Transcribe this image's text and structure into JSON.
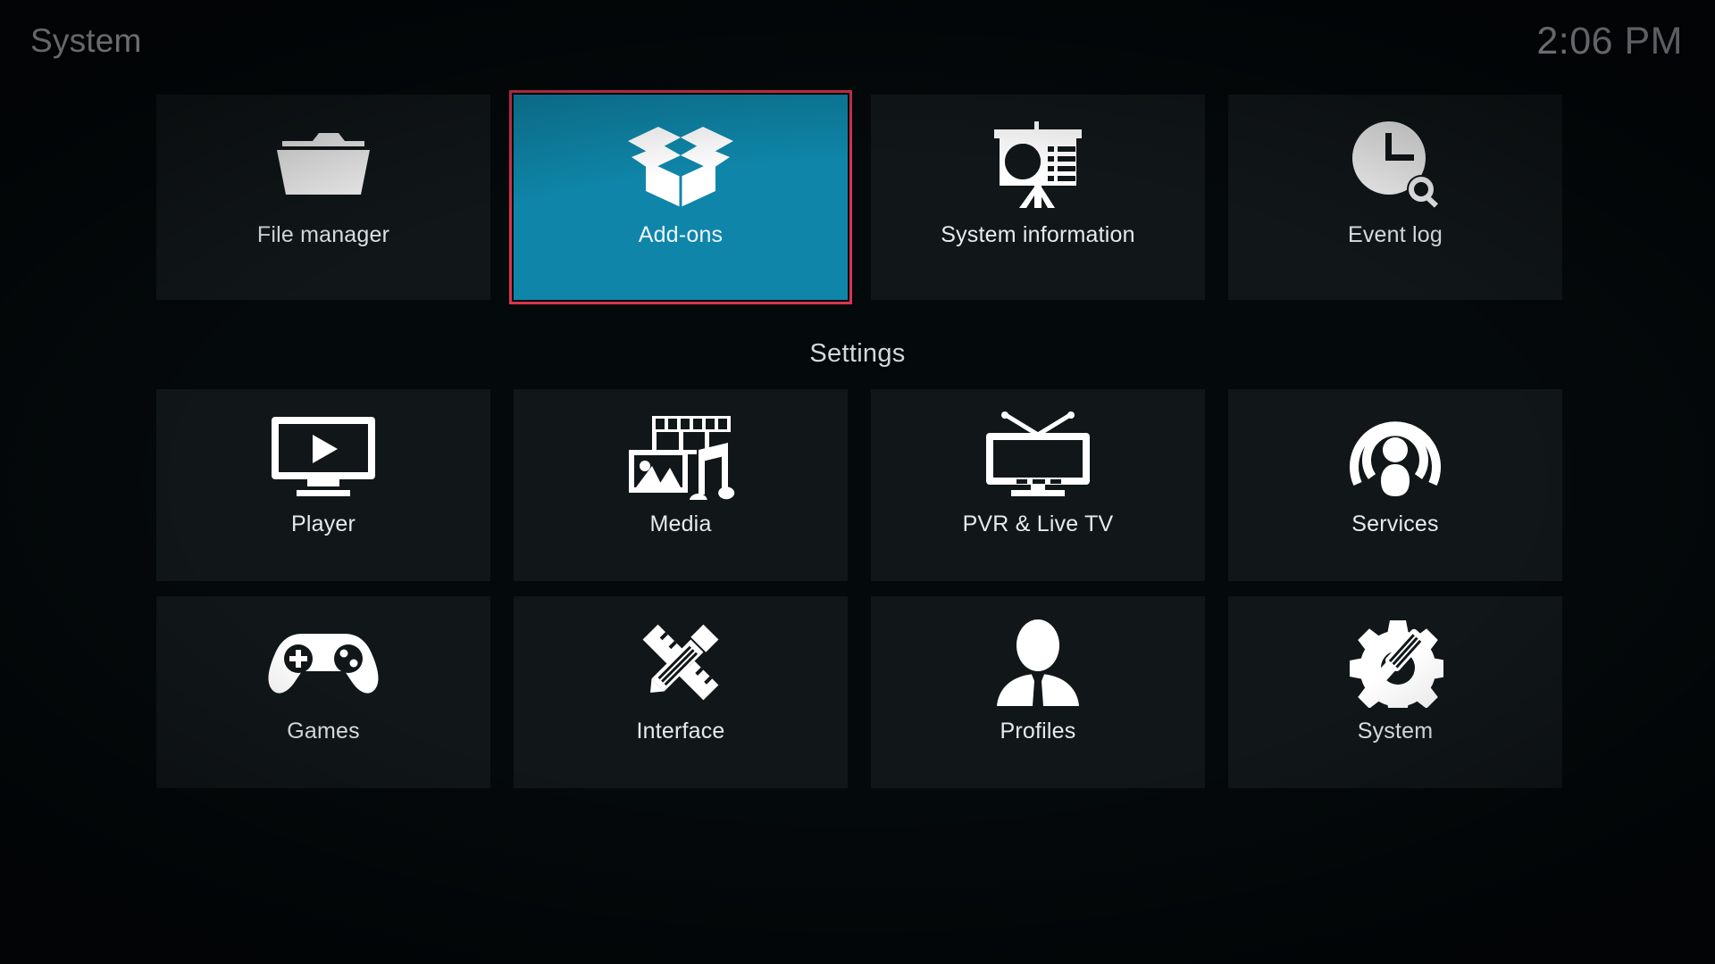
{
  "header": {
    "title": "System",
    "clock": "2:06 PM"
  },
  "colors": {
    "tile_background": "#111719",
    "tile_focused_background": "#0f86a9",
    "focus_border": "#d8344f",
    "icon": "#ffffff",
    "label_text": "#e6ebed",
    "background_teal": "#0a3a4c"
  },
  "section": {
    "settings_heading": "Settings"
  },
  "top_row": {
    "items": [
      {
        "label": "File manager",
        "icon": "folder-icon",
        "focused": false
      },
      {
        "label": "Add-ons",
        "icon": "open-box-icon",
        "focused": true
      },
      {
        "label": "System information",
        "icon": "presentation-icon",
        "focused": false
      },
      {
        "label": "Event log",
        "icon": "clock-search-icon",
        "focused": false
      }
    ]
  },
  "settings_rows": [
    {
      "items": [
        {
          "label": "Player",
          "icon": "monitor-play-icon",
          "focused": false
        },
        {
          "label": "Media",
          "icon": "media-library-icon",
          "focused": false
        },
        {
          "label": "PVR & Live TV",
          "icon": "tv-antenna-icon",
          "focused": false
        },
        {
          "label": "Services",
          "icon": "broadcast-icon",
          "focused": false
        }
      ]
    },
    {
      "items": [
        {
          "label": "Games",
          "icon": "gamepad-icon",
          "focused": false
        },
        {
          "label": "Interface",
          "icon": "pencil-ruler-icon",
          "focused": false
        },
        {
          "label": "Profiles",
          "icon": "person-icon",
          "focused": false
        },
        {
          "label": "System",
          "icon": "gear-screwdriver-icon",
          "focused": false
        }
      ]
    }
  ]
}
